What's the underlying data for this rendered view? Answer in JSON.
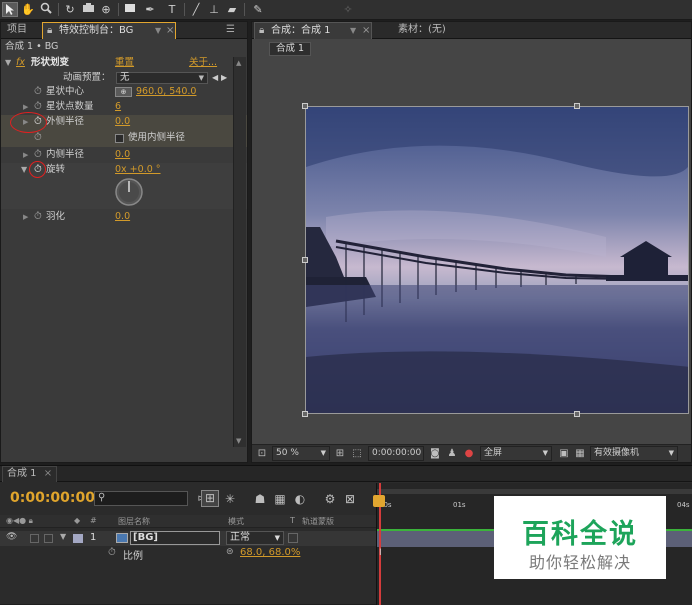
{
  "toolbar": {
    "tools": [
      "selection-tool",
      "hand-tool",
      "zoom-tool",
      "rotate-tool",
      "camera-tool",
      "pan-behind-tool",
      "rectangle-tool",
      "pen-tool",
      "type-tool",
      "brush-tool",
      "clone-stamp-tool",
      "eraser-tool",
      "roto-brush-tool",
      "puppet-tool"
    ]
  },
  "left_panel": {
    "tabs": [
      "项目",
      "特效控制台：BG",
      "×"
    ],
    "breadcrumb": "合成 1 • BG",
    "effect": {
      "prefix": "fx",
      "name": "形状划变",
      "reset": "重置",
      "about": "关于..."
    },
    "animation_preset": {
      "label": "动画预置：",
      "value": "无"
    },
    "properties": [
      {
        "label": "星状中心",
        "value": "960.0, 540.0"
      },
      {
        "label": "星状点数量",
        "value": "6"
      },
      {
        "label": "外侧半径",
        "value": "0.0"
      },
      {
        "label": "使用内侧半径",
        "value": ""
      },
      {
        "label": "内侧半径",
        "value": "0.0"
      },
      {
        "label": "旋转",
        "value": "0x +0.0 °"
      },
      {
        "label": "羽化",
        "value": "0.0"
      }
    ]
  },
  "viewer": {
    "tabs": [
      "合成：合成 1",
      "素材：(无)"
    ],
    "comp_tab": "合成 1",
    "zoom": "50 %",
    "timecode": "0:00:00:00",
    "resolution": "全屏",
    "camera": "有效摄像机"
  },
  "timeline": {
    "tab": "合成 1",
    "timecode": "0:00:00:00",
    "search_placeholder": "",
    "columns": [
      "#",
      "图层名称",
      "模式",
      "T",
      "轨道蒙版"
    ],
    "ruler": [
      "00s",
      "01s",
      "04s"
    ],
    "layer": {
      "index": "1",
      "name": "[BG]",
      "mode": "正常"
    },
    "subprop": {
      "label": "比例",
      "value": "68.0, 68.0%"
    }
  },
  "watermark": {
    "title": "百科全说",
    "subtitle": "助你轻松解决"
  },
  "colors": {
    "accent": "#d29a2a",
    "active_tab_border": "#e2a630",
    "annotation_red": "#e12020",
    "playhead": "#d43c3c"
  }
}
